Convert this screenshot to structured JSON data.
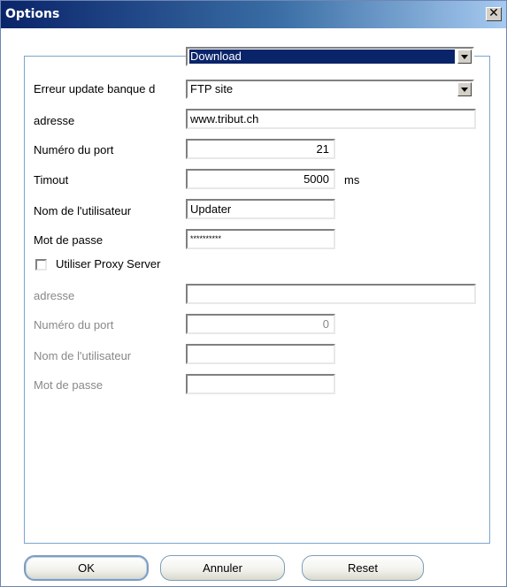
{
  "window": {
    "title": "Options",
    "close_glyph": "✕"
  },
  "section_select": {
    "value": "Download"
  },
  "labels": {
    "error_update": "Erreur update banque d",
    "address": "adresse",
    "port": "Numéro du port",
    "timeout": "Timout",
    "user": "Nom de l'utilisateur",
    "password": "Mot de passe"
  },
  "values": {
    "source": "FTP site",
    "address": "www.tribut.ch",
    "port": "21",
    "timeout": "5000",
    "timeout_unit": "ms",
    "user": "Updater",
    "password": "**********"
  },
  "proxy": {
    "checkbox_label": "Utiliser Proxy Server",
    "checked": false,
    "labels": {
      "address": "adresse",
      "port": "Numéro du port",
      "user": "Nom de l'utilisateur",
      "password": "Mot de passe"
    },
    "values": {
      "address": "",
      "port": "0",
      "user": "",
      "password": ""
    }
  },
  "buttons": {
    "ok": "OK",
    "cancel": "Annuler",
    "reset": "Reset"
  },
  "colors": {
    "titlebar_start": "#0a246a",
    "titlebar_end": "#a6caf0",
    "group_border": "#7aa6cc",
    "disabled_text": "#888888"
  }
}
